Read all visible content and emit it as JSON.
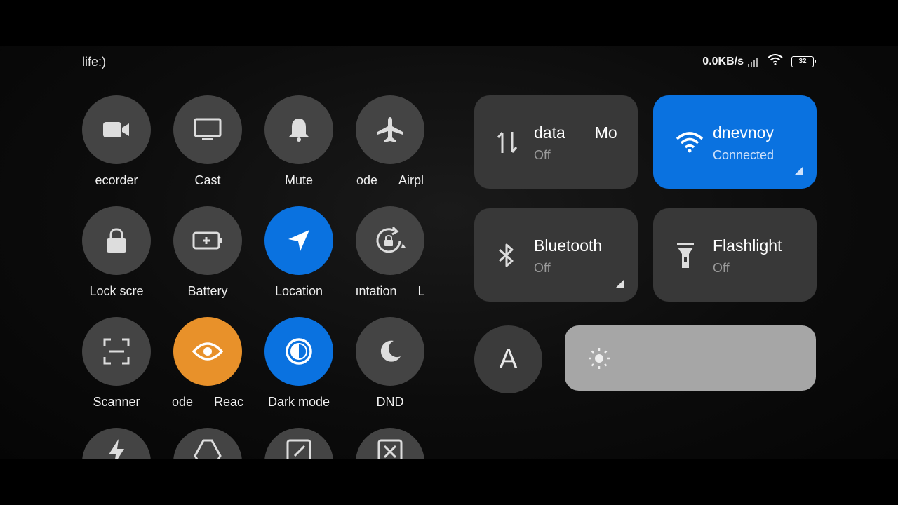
{
  "status_bar": {
    "carrier": "life:)",
    "speed": "0.0KB/s",
    "battery": "32",
    "icons": [
      "signal-icon",
      "wifi-icon",
      "battery-icon"
    ]
  },
  "tiles": [
    {
      "label": "ecorder",
      "icon": "video-camera-icon",
      "state": "off"
    },
    {
      "label": "Cast",
      "icon": "monitor-icon",
      "state": "off"
    },
    {
      "label": "Mute",
      "icon": "bell-icon",
      "state": "off"
    },
    {
      "label": "ode",
      "label2": "Airpl",
      "icon": "airplane-icon",
      "state": "off"
    },
    {
      "label": "Lock scre",
      "icon": "lock-icon",
      "state": "off"
    },
    {
      "label": "Battery",
      "icon": "battery-saver-icon",
      "state": "off"
    },
    {
      "label": "Location",
      "icon": "location-arrow-icon",
      "state": "on"
    },
    {
      "label": "ıntation",
      "label2": "L",
      "icon": "rotate-lock-icon",
      "state": "off"
    },
    {
      "label": "Scanner",
      "icon": "scanner-icon",
      "state": "off"
    },
    {
      "label": "ode",
      "label2": "Reac",
      "icon": "eye-icon",
      "state": "on-orange"
    },
    {
      "label": "Dark mode",
      "icon": "dark-mode-icon",
      "state": "on"
    },
    {
      "label": "DND",
      "icon": "moon-icon",
      "state": "off"
    }
  ],
  "cards": {
    "mobile_data": {
      "title_a": "data",
      "title_b": "Mo",
      "status": "Off",
      "icon": "data-arrows-icon"
    },
    "wifi": {
      "title": "dnevnoy",
      "status": "Connected",
      "icon": "wifi-icon",
      "accent": "#0a72e0"
    },
    "bluetooth": {
      "title": "Bluetooth",
      "status": "Off",
      "icon": "bluetooth-icon"
    },
    "flashlight": {
      "title": "Flashlight",
      "status": "Off",
      "icon": "flashlight-icon"
    }
  },
  "auto_brightness": {
    "label": "A"
  },
  "brightness": {
    "icon": "sun-icon"
  }
}
